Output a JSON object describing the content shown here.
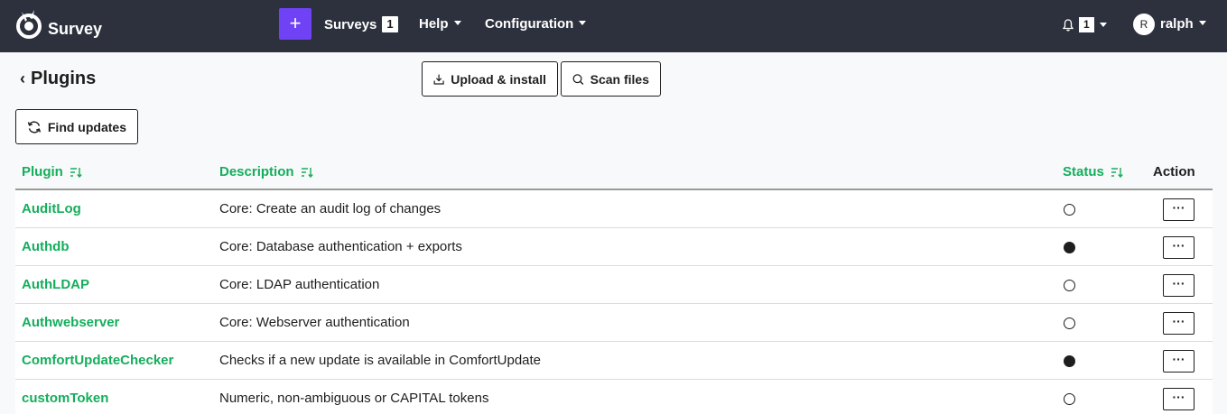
{
  "navbar": {
    "brand": "Survey",
    "add_button_icon": "plus-icon",
    "surveys_label": "Surveys",
    "surveys_count": "1",
    "help_label": "Help",
    "configuration_label": "Configuration",
    "notifications_count": "1",
    "avatar_initial": "R",
    "user_name": "ralph",
    "bg_color": "#2d313d",
    "accent_color": "#6f42f5"
  },
  "page": {
    "title": "Plugins",
    "upload_label": "Upload & install",
    "scan_label": "Scan files",
    "find_updates_label": "Find updates"
  },
  "table": {
    "columns": {
      "plugin": "Plugin",
      "description": "Description",
      "status": "Status",
      "action": "Action"
    },
    "link_color": "#14ae5c",
    "rows": [
      {
        "name": "AuditLog",
        "description": "Core: Create an audit log of changes",
        "active": false,
        "action": "···"
      },
      {
        "name": "Authdb",
        "description": "Core: Database authentication + exports",
        "active": true,
        "action": "···"
      },
      {
        "name": "AuthLDAP",
        "description": "Core: LDAP authentication",
        "active": false,
        "action": "···"
      },
      {
        "name": "Authwebserver",
        "description": "Core: Webserver authentication",
        "active": false,
        "action": "···"
      },
      {
        "name": "ComfortUpdateChecker",
        "description": "Checks if a new update is available in ComfortUpdate",
        "active": true,
        "action": "···"
      },
      {
        "name": "customToken",
        "description": "Numeric, non-ambiguous or CAPITAL tokens",
        "active": false,
        "action": "···"
      }
    ]
  }
}
